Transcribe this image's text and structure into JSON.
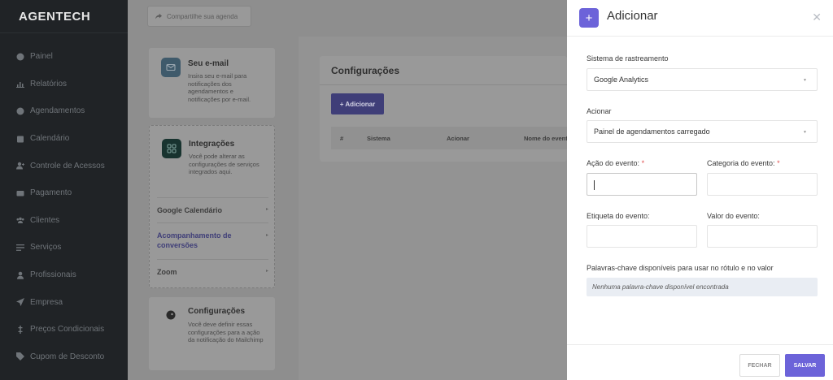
{
  "app": {
    "brand": "AGENTECH"
  },
  "sidebar": {
    "items": [
      {
        "label": "Painel",
        "icon": "dashboard-icon"
      },
      {
        "label": "Relatórios",
        "icon": "chart-icon"
      },
      {
        "label": "Agendamentos",
        "icon": "clock-icon"
      },
      {
        "label": "Calendário",
        "icon": "calendar-icon"
      },
      {
        "label": "Controle de Acessos",
        "icon": "user-plus-icon"
      },
      {
        "label": "Pagamento",
        "icon": "credit-card-icon"
      },
      {
        "label": "Clientes",
        "icon": "users-icon"
      },
      {
        "label": "Serviços",
        "icon": "list-icon"
      },
      {
        "label": "Profissionais",
        "icon": "user-icon"
      },
      {
        "label": "Empresa",
        "icon": "send-icon"
      },
      {
        "label": "Preços Condicionais",
        "icon": "dollar-icon"
      },
      {
        "label": "Cupom de Desconto",
        "icon": "tag-icon"
      }
    ]
  },
  "main": {
    "share_label": "Compartilhe sua agenda",
    "email_card": {
      "title": "Seu e-mail",
      "text": "Insira seu e-mail para notificações dos agendamentos e notificações por e-mail."
    },
    "integrations_card": {
      "title": "Integrações",
      "text": "Você pode alterar as configurações de serviços integrados aqui.",
      "links": [
        "Google Calendário",
        "Acompanhamento de conversões",
        "Zoom"
      ]
    },
    "config_card": {
      "title": "Configurações",
      "text": "Você deve definir essas configurações para a ação da notificação do Mailchimp"
    },
    "panel": {
      "title": "Configurações",
      "add_label": "+ Adicionar",
      "columns": [
        "#",
        "Sistema",
        "Acionar",
        "Nome do evento"
      ]
    }
  },
  "modal": {
    "title": "Adicionar",
    "tracking_label": "Sistema de rastreamento",
    "tracking_value": "Google Analytics",
    "trigger_label": "Acionar",
    "trigger_value": "Painel de agendamentos carregado",
    "action_label": "Ação do evento:",
    "category_label": "Categoria do evento:",
    "required_mark": "*",
    "event_label_label": "Etiqueta do evento:",
    "event_value_label": "Valor do evento:",
    "keywords_label": "Palavras-chave disponíveis para usar no rótulo e no valor",
    "keywords_empty": "Nenhuma palavra-chave disponível encontrada",
    "cancel_label": "FECHAR",
    "save_label": "SALVAR"
  },
  "colors": {
    "accent": "#6c63d9",
    "sidebar": "#202326"
  }
}
